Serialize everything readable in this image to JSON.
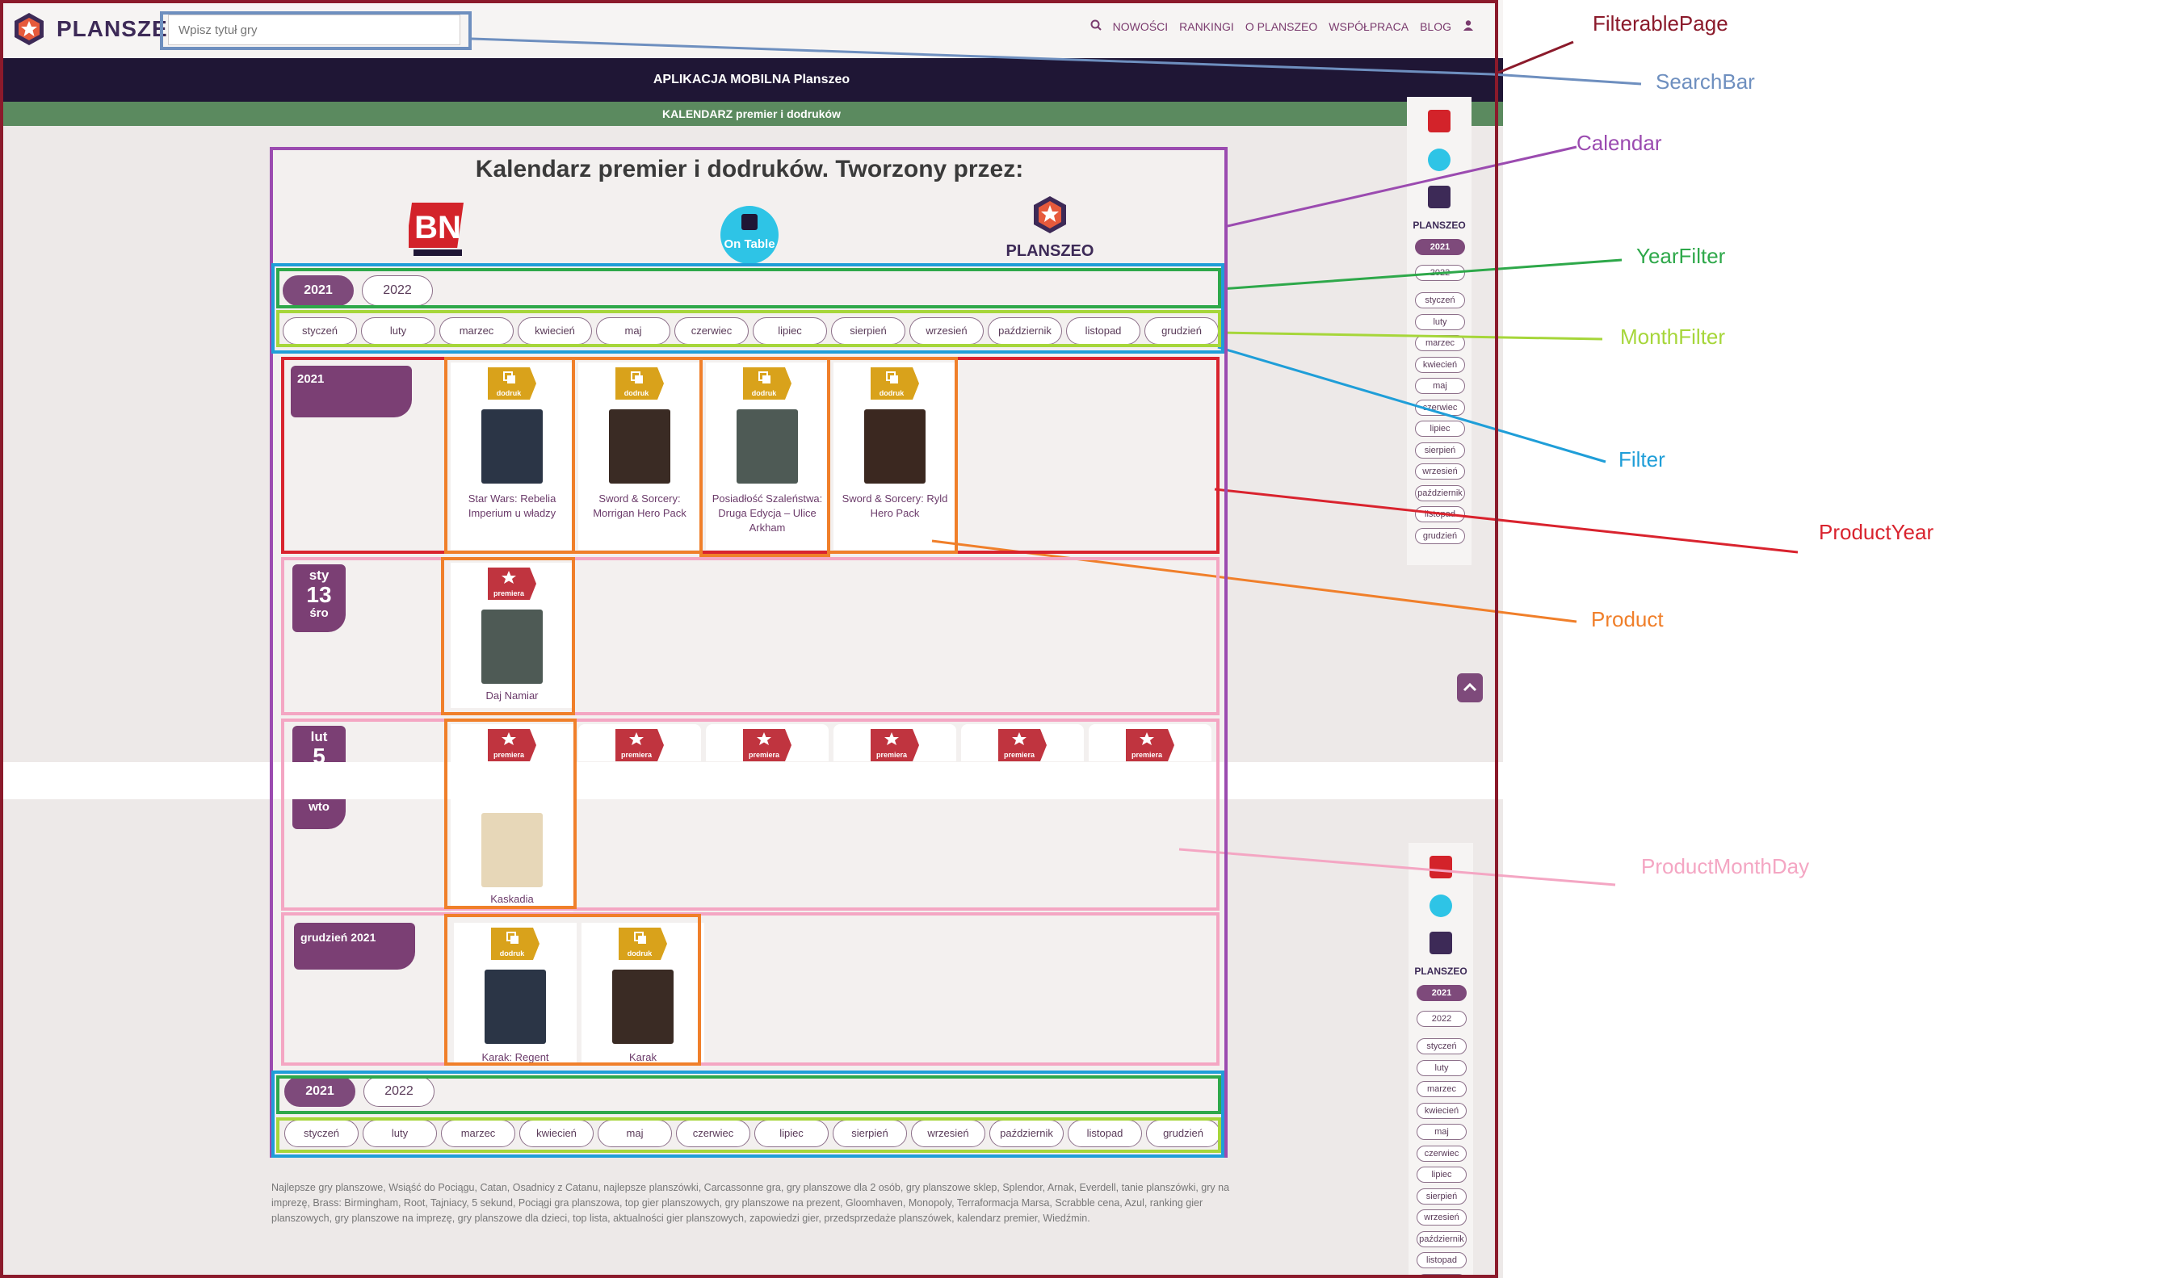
{
  "header": {
    "logo_text": "PLANSZEO",
    "search_placeholder": "Wpisz tytuł gry",
    "nav": [
      "NOWOŚCI",
      "RANKINGI",
      "O PLANSZEO",
      "WSPÓŁPRACA",
      "BLOG"
    ],
    "nav_icons": [
      "search-icon",
      "user-icon"
    ]
  },
  "mobile_bar": "APLIKACJA MOBILNA Planszeo",
  "calendar_bar": "KALENDARZ premier i dodruków",
  "calendar": {
    "title": "Kalendarz premier i dodruków. Tworzony przez:",
    "partners": [
      "BN BOARD NEWS",
      "On Table",
      "PLANSZEO"
    ],
    "years": [
      "2021",
      "2022"
    ],
    "active_year": "2021",
    "months": [
      "styczeń",
      "luty",
      "marzec",
      "kwiecień",
      "maj",
      "czerwiec",
      "lipiec",
      "sierpień",
      "wrzesień",
      "październik",
      "listopad",
      "grudzień"
    ],
    "sections": [
      {
        "date": {
          "label": "2021"
        },
        "products": [
          {
            "badge": "dodruk",
            "title": "Star Wars: Rebelia Imperium u władzy"
          },
          {
            "badge": "dodruk",
            "title": "Sword & Sorcery: Morrigan Hero Pack"
          },
          {
            "badge": "dodruk",
            "title": "Posiadłość Szaleństwa: Druga Edycja – Ulice Arkham"
          },
          {
            "badge": "dodruk",
            "title": "Sword & Sorcery: Ryld Hero Pack"
          }
        ]
      },
      {
        "date": {
          "month": "sty",
          "day": "13",
          "weekday": "śro"
        },
        "products": [
          {
            "badge": "premiera",
            "title": "Daj Namiar"
          }
        ]
      },
      {
        "date": {
          "month": "lut",
          "day": "5",
          "weekday": "wto"
        },
        "products": [
          {
            "badge": "premiera",
            "title": "Kaskadia"
          },
          {
            "badge": "premiera",
            "title": ""
          },
          {
            "badge": "premiera",
            "title": ""
          },
          {
            "badge": "premiera",
            "title": ""
          },
          {
            "badge": "premiera",
            "title": ""
          },
          {
            "badge": "premiera",
            "title": ""
          }
        ]
      },
      {
        "date": {
          "label": "grudzień 2021"
        },
        "products": [
          {
            "badge": "dodruk",
            "title": "Karak: Regent"
          },
          {
            "badge": "dodruk",
            "title": "Karak"
          }
        ]
      }
    ]
  },
  "footer_text": "Najlepsze gry planszowe, Wsiąść do Pociągu, Catan, Osadnicy z Catanu, najlepsze planszówki, Carcassonne gra, gry planszowe dla 2 osób, gry planszowe sklep, Splendor, Arnak, Everdell, tanie planszówki, gry na imprezę, Brass: Birmingham, Root, Tajniacy, 5 sekund, Pociągi gra planszowa, top gier planszowych, gry planszowe na prezent, Gloomhaven, Monopoly, Terraformacja Marsa, Scrabble cena, Azul, ranking gier planszowych, gry planszowe na imprezę, gry planszowe dla dzieci, top lista, aktualności gier planszowych, zapowiedzi gier, przedsprzedaże planszówek, kalendarz premier, Wiedźmin.",
  "side_panel": {
    "partner_name": "PLANSZEO",
    "years": [
      "2021",
      "2022"
    ],
    "months": [
      "styczeń",
      "luty",
      "marzec",
      "kwiecień",
      "maj",
      "czerwiec",
      "lipiec",
      "sierpień",
      "wrzesień",
      "październik",
      "listopad",
      "grudzień"
    ]
  },
  "annotations": [
    {
      "label": "FilterablePage",
      "color": "#8b1a2b"
    },
    {
      "label": "SearchBar",
      "color": "#6e8fbf"
    },
    {
      "label": "Calendar",
      "color": "#9b4bb0"
    },
    {
      "label": "YearFilter",
      "color": "#2ea84a"
    },
    {
      "label": "MonthFilter",
      "color": "#a6d63a"
    },
    {
      "label": "Filter",
      "color": "#1f9ed8"
    },
    {
      "label": "ProductYear",
      "color": "#d9232e"
    },
    {
      "label": "Product",
      "color": "#f07f2a"
    },
    {
      "label": "ProductMonthDay",
      "color": "#f4a6c3"
    }
  ],
  "colors": {
    "brand_purple": "#7e4a7b",
    "dark_navy": "#1f1635",
    "green_bar": "#5b8a5f",
    "dodruk_gold": "#d9a21b",
    "premiera_red": "#c0343f"
  }
}
